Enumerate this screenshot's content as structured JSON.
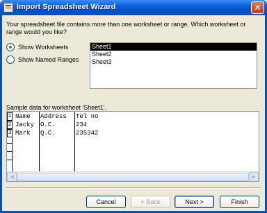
{
  "window": {
    "title": "Import Spreadsheet Wizard",
    "close_glyph": "✕"
  },
  "intro_text": "Your spreadsheet file contains more than one worksheet or range. Which worksheet or range would you like?",
  "options": {
    "show_worksheets": {
      "label": "Show Worksheets",
      "checked": true
    },
    "show_named_ranges": {
      "label": "Show Named Ranges",
      "checked": false
    }
  },
  "sheets": [
    "Sheet1",
    "Sheet2",
    "Sheet3"
  ],
  "selected_sheet": "Sheet1",
  "sample_label": "Sample data for worksheet 'Sheet1'.",
  "sample": {
    "row_numbers": [
      "1",
      "2",
      "3"
    ],
    "rows": [
      [
        "Name",
        "Address",
        "Tel no"
      ],
      [
        "Jacky",
        "O.C.",
        "234"
      ],
      [
        "Mark",
        "Q.C.",
        "235342"
      ]
    ]
  },
  "scrollbar": {
    "left_arrow": "◀",
    "right_arrow": "▶"
  },
  "buttons": {
    "cancel": "Cancel",
    "back": "< Back",
    "next": "Next >",
    "finish": "Finish"
  }
}
